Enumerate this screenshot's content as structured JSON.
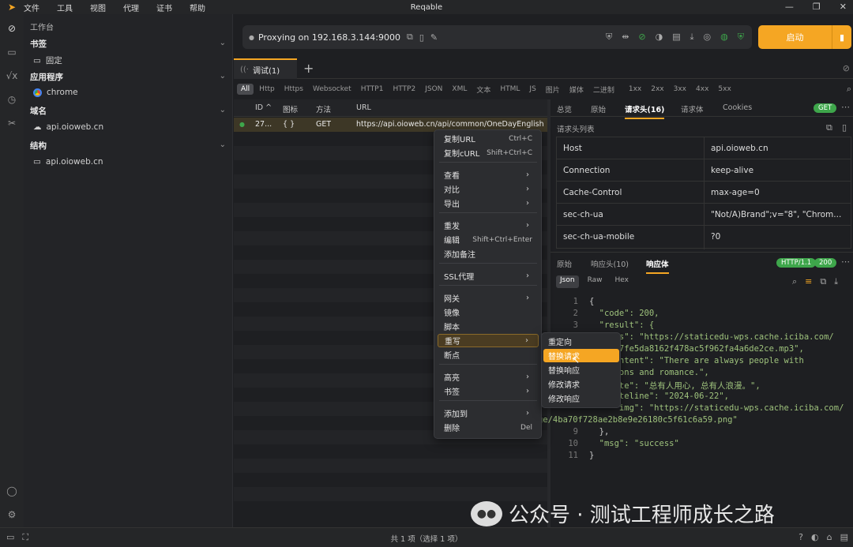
{
  "app": {
    "title": "Reqable"
  },
  "menu": [
    "文件",
    "工具",
    "视图",
    "代理",
    "证书",
    "帮助"
  ],
  "sidebar": {
    "header": "工作台",
    "sections": [
      {
        "title": "书签",
        "items": [
          "固定"
        ]
      },
      {
        "title": "应用程序",
        "items": [
          "chrome"
        ]
      },
      {
        "title": "域名",
        "items": [
          "api.oioweb.cn"
        ]
      },
      {
        "title": "结构",
        "items": [
          "api.oioweb.cn"
        ]
      }
    ]
  },
  "proxy": {
    "status": "Proxying on 192.168.3.144:9000"
  },
  "start_button": {
    "label": "启动"
  },
  "tabs": [
    {
      "label": "调试(1)"
    }
  ],
  "filters": [
    "All",
    "Http",
    "Https",
    "Websocket",
    "HTTP1",
    "HTTP2",
    "JSON",
    "XML",
    "文本",
    "HTML",
    "JS",
    "图片",
    "媒体",
    "二进制",
    "1xx",
    "2xx",
    "3xx",
    "4xx",
    "5xx"
  ],
  "list": {
    "headers": [
      "ID",
      "图标",
      "方法",
      "URL"
    ],
    "rows": [
      {
        "id": "27...",
        "icon": "{ }",
        "method": "GET",
        "url": "https://api.oioweb.cn/api/common/OneDayEnglish"
      }
    ]
  },
  "request_panel": {
    "tabs": [
      "总览",
      "原始",
      "请求头(16)",
      "请求体",
      "Cookies"
    ],
    "method_badge": "GET",
    "list_title": "请求头列表",
    "headers": [
      {
        "key": "Host",
        "value": "api.oioweb.cn"
      },
      {
        "key": "Connection",
        "value": "keep-alive"
      },
      {
        "key": "Cache-Control",
        "value": "max-age=0"
      },
      {
        "key": "sec-ch-ua",
        "value": "\"Not/A)Brand\";v=\"8\", \"Chrom..."
      },
      {
        "key": "sec-ch-ua-mobile",
        "value": "?0"
      }
    ]
  },
  "response_panel": {
    "tabs": [
      "原始",
      "响应头(10)",
      "响应体"
    ],
    "protocol_badge": "HTTP/1.1",
    "status_badge": "200",
    "formats": [
      "Json",
      "Raw",
      "Hex"
    ],
    "code_lines": [
      {
        "n": "1",
        "t": "{"
      },
      {
        "n": "2",
        "t": "  \"code\": 200,"
      },
      {
        "n": "3",
        "t": "  \"result\": {"
      },
      {
        "n": "",
        "t": "      s\": \"https://staticedu-wps.cache.iciba.com/"
      },
      {
        "n": "",
        "t": "      7fe5da8162f478ac5f962fa4a6de2ce.mp3\","
      },
      {
        "n": "",
        "t": "      ntent\": \"There are always people with"
      },
      {
        "n": "",
        "t": "      ons and romance.\","
      },
      {
        "n": "",
        "t": "      te\": \"总有人用心, 总有人浪漫。\","
      },
      {
        "n": "",
        "t": "      teline\": \"2024-06-22\","
      },
      {
        "n": "",
        "t": "      img\": \"https://staticedu-wps.cache.iciba.com/"
      },
      {
        "n": "",
        "t": "image/4ba70f728ae2b8e9e26180c5f61c6a59.png\""
      },
      {
        "n": "9",
        "t": "  },"
      },
      {
        "n": "10",
        "t": "  \"msg\": \"success\""
      },
      {
        "n": "11",
        "t": "}"
      }
    ]
  },
  "context_menu": {
    "items": [
      {
        "label": "复制URL",
        "shortcut": "Ctrl+C"
      },
      {
        "label": "复制cURL",
        "shortcut": "Shift+Ctrl+C"
      },
      {
        "label": "查看",
        "arrow": true
      },
      {
        "label": "对比",
        "arrow": true
      },
      {
        "label": "导出",
        "arrow": true
      },
      {
        "label": "重发",
        "arrow": true
      },
      {
        "label": "编辑",
        "shortcut": "Shift+Ctrl+Enter"
      },
      {
        "label": "添加备注"
      },
      {
        "label": "SSL代理",
        "arrow": true
      },
      {
        "label": "网关",
        "arrow": true
      },
      {
        "label": "镜像"
      },
      {
        "label": "脚本"
      },
      {
        "label": "重写",
        "arrow": true
      },
      {
        "label": "断点"
      },
      {
        "label": "高亮",
        "arrow": true
      },
      {
        "label": "书签",
        "arrow": true
      },
      {
        "label": "添加到",
        "arrow": true
      },
      {
        "label": "删除",
        "shortcut": "Del"
      }
    ],
    "submenu": [
      "重定向",
      "替换请求",
      "替换响应",
      "修改请求",
      "修改响应"
    ]
  },
  "status": {
    "text": "共 1 项（选择 1 项）"
  },
  "watermark": {
    "text": "公众号 · 测试工程师成长之路"
  },
  "colors": {
    "accent": "#f5a623",
    "badge_green": "#3ea64b",
    "background": "#1e1f22"
  }
}
